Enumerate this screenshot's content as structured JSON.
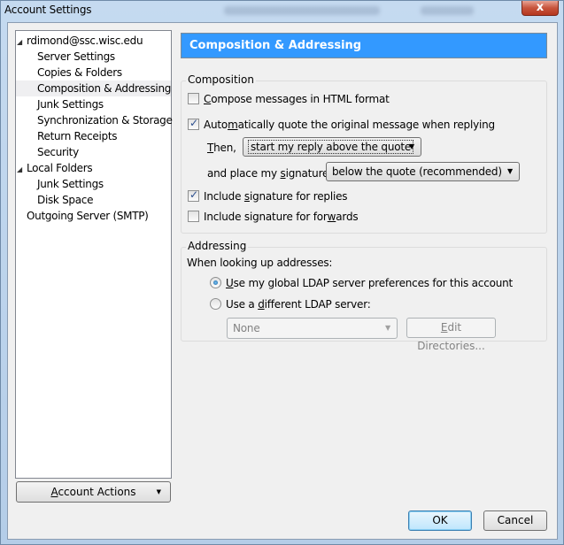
{
  "window": {
    "title": "Account Settings",
    "close_label": "x"
  },
  "tree": {
    "items": [
      {
        "label": "rdimond@ssc.wisc.edu",
        "level": 0,
        "expanded": true
      },
      {
        "label": "Server Settings",
        "level": 1
      },
      {
        "label": "Copies & Folders",
        "level": 1
      },
      {
        "label": "Composition & Addressing",
        "level": 1,
        "selected": true
      },
      {
        "label": "Junk Settings",
        "level": 1
      },
      {
        "label": "Synchronization & Storage",
        "level": 1
      },
      {
        "label": "Return Receipts",
        "level": 1
      },
      {
        "label": "Security",
        "level": 1
      },
      {
        "label": "Local Folders",
        "level": 0,
        "expanded": true
      },
      {
        "label": "Junk Settings",
        "level": 1
      },
      {
        "label": "Disk Space",
        "level": 1
      },
      {
        "label": "Outgoing Server (SMTP)",
        "level": 0
      }
    ],
    "account_actions": {
      "accel": "A",
      "rest": "ccount Actions"
    }
  },
  "panel": {
    "header": "Composition & Addressing",
    "composition": {
      "caption": "Composition",
      "html_format": {
        "accel": "C",
        "rest": "ompose messages in HTML format",
        "checked": false
      },
      "auto_quote": {
        "pre": "Auto",
        "accel": "m",
        "rest": "atically quote the original message when replying",
        "checked": true
      },
      "then_label": {
        "accel": "T",
        "rest": "hen,"
      },
      "reply_position": {
        "value": "start my reply above the quote"
      },
      "signature_label": {
        "pre": "and place my ",
        "accel": "s",
        "rest": "ignature"
      },
      "signature_position": {
        "value": "below the quote (recommended)"
      },
      "sig_replies": {
        "pre": "Include ",
        "accel": "s",
        "rest": "ignature for replies",
        "checked": true
      },
      "sig_forwards": {
        "pre": "Include signature for for",
        "accel": "w",
        "rest": "ards",
        "checked": false
      }
    },
    "addressing": {
      "caption": "Addressing",
      "lookup_label": "When looking up addresses:",
      "global_ldap": {
        "accel": "U",
        "rest": "se my global LDAP server preferences for this account",
        "checked": true
      },
      "different_ldap": {
        "pre": "Use a ",
        "accel": "d",
        "rest": "ifferent LDAP server:",
        "checked": false
      },
      "ldap_server": {
        "value": "None"
      },
      "edit_directories": {
        "accel": "E",
        "rest": "dit Directories..."
      }
    }
  },
  "footer": {
    "ok_label": "OK",
    "cancel_label": "Cancel"
  }
}
